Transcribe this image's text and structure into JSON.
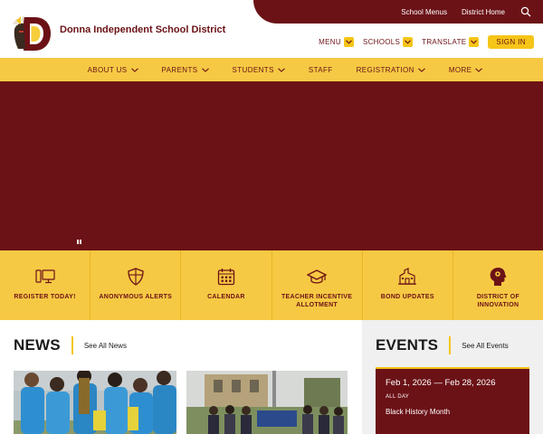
{
  "header": {
    "district_name": "Donna Independent School District",
    "top_links": [
      "School Menus",
      "District Home"
    ],
    "search_icon": "search-icon",
    "menu_label": "MENU",
    "schools_label": "SCHOOLS",
    "translate_label": "TRANSLATE",
    "sign_in_label": "SIGN IN"
  },
  "nav": {
    "items": [
      "ABOUT US",
      "PARENTS",
      "STUDENTS",
      "STAFF",
      "REGISTRATION",
      "MORE"
    ]
  },
  "quick_links": [
    {
      "label": "REGISTER TODAY!",
      "icon": "computer-icon"
    },
    {
      "label": "ANONYMOUS ALERTS",
      "icon": "shield-icon"
    },
    {
      "label": "CALENDAR",
      "icon": "calendar-icon"
    },
    {
      "label": "TEACHER INCENTIVE ALLOTMENT",
      "icon": "graduation-cap-icon"
    },
    {
      "label": "BOND UPDATES",
      "icon": "school-building-icon"
    },
    {
      "label": "DISTRICT OF INNOVATION",
      "icon": "head-gear-icon"
    }
  ],
  "news": {
    "title": "NEWS",
    "see_all": "See All News"
  },
  "events": {
    "title": "EVENTS",
    "see_all": "See All Events",
    "items": [
      {
        "date": "Feb 1, 2026 — Feb 28, 2026",
        "time": "ALL DAY",
        "title": "Black History Month"
      }
    ]
  },
  "colors": {
    "maroon": "#6b1216",
    "gold": "#f5c518",
    "nav_yellow": "#f6c944"
  }
}
